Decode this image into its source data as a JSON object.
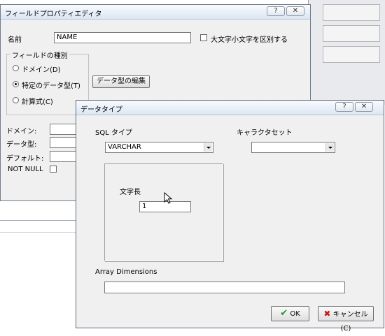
{
  "field_editor": {
    "title": "フィールドプロパティエディタ",
    "help_glyph": "?",
    "close_glyph": "✕",
    "name_label": "名前",
    "name_value": "NAME",
    "case_sensitive_label": "大文字小文字を区別する",
    "field_kind_group": "フィールドの種別",
    "radio_domain": "ドメイン(D)",
    "radio_specific_type": "特定のデータ型(T)",
    "radio_computed": "計算式(C)",
    "edit_type_button": "データ型の編集",
    "domain_label": "ドメイン:",
    "datatype_label": "データ型:",
    "default_label": "デフォルト:",
    "not_null_label": "NOT NULL"
  },
  "datatype_dialog": {
    "title": "データタイプ",
    "help_glyph": "?",
    "close_glyph": "✕",
    "sql_type_label": "SQL タイプ",
    "sql_type_value": "VARCHAR",
    "charset_label": "キャラクタセット",
    "charset_value": "",
    "length_label": "文字長",
    "length_value": "1",
    "array_dimensions_label": "Array Dimensions",
    "array_dimensions_value": "",
    "ok_button": "OK",
    "cancel_button": "キャンセル(C)"
  }
}
